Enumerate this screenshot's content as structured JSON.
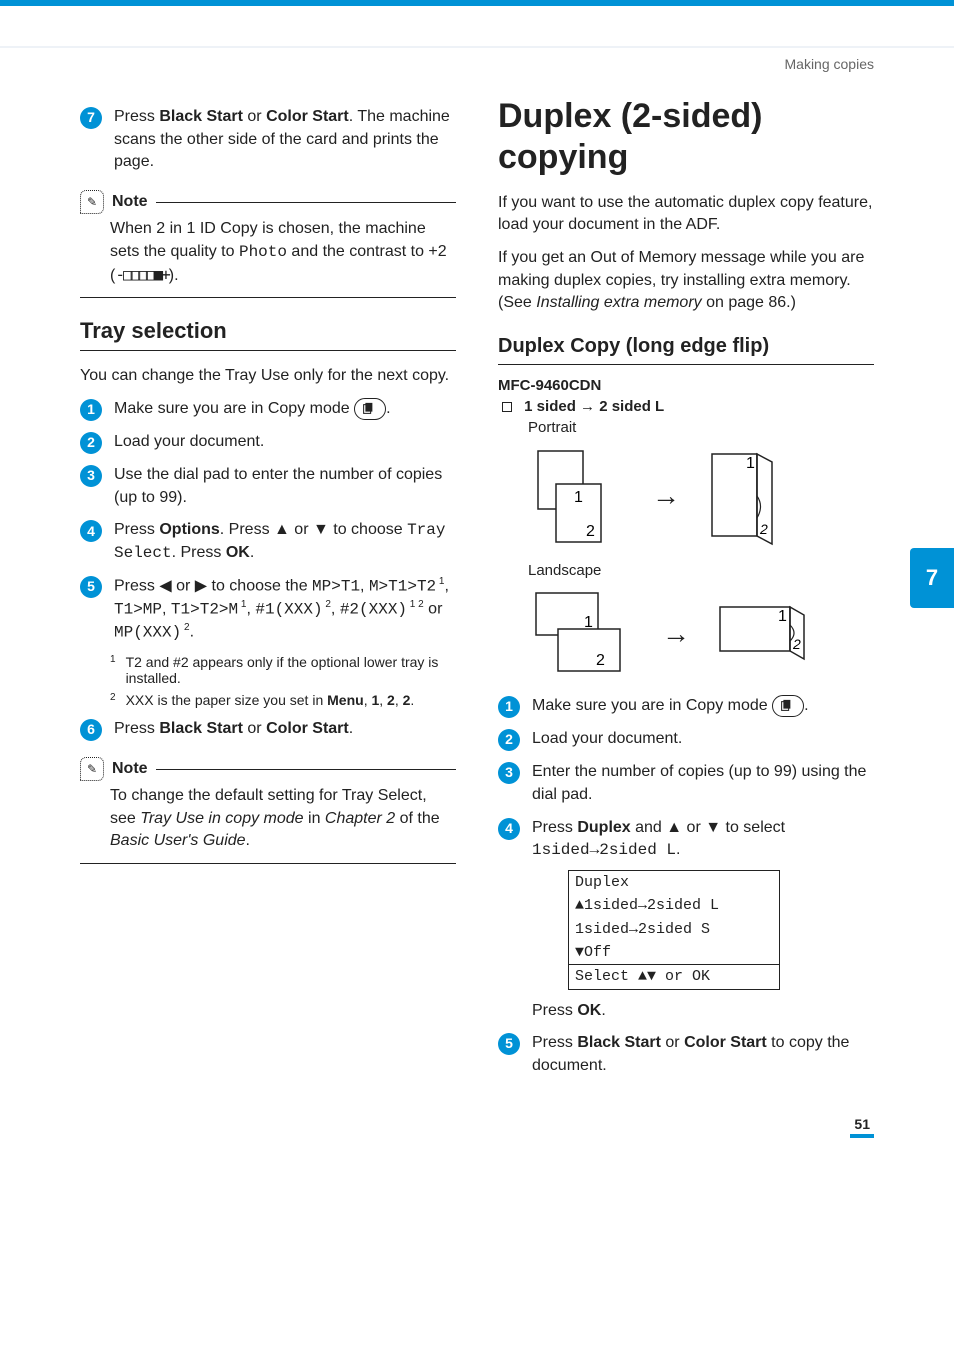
{
  "running_head": "Making copies",
  "tab_number": "7",
  "page_number": "51",
  "left": {
    "step7": {
      "n": "7",
      "pre": "Press ",
      "b1": "Black Start",
      "mid": " or ",
      "b2": "Color Start",
      "post": ". The machine scans the other side of the card and prints the page."
    },
    "note1_label": "Note",
    "note1": {
      "a": "When 2 in 1 ID Copy is chosen, the machine sets the quality to ",
      "mono": "Photo",
      "b": " and the contrast to +2 (",
      "bar": "-□□□□■+",
      "c": ")."
    },
    "h2": "Tray selection",
    "intro": "You can change the Tray Use only for the next copy.",
    "s1": {
      "n": "1",
      "t": "Make sure you are in Copy mode "
    },
    "s2": {
      "n": "2",
      "t": "Load your document."
    },
    "s3": {
      "n": "3",
      "t": "Use the dial pad to enter the number of copies (up to 99)."
    },
    "s4": {
      "n": "4",
      "a": "Press ",
      "b1": "Options",
      "b": ". Press ▲ or ▼ to choose ",
      "mono": "Tray Select",
      "c": ". Press ",
      "b2": "OK",
      "d": "."
    },
    "s5": {
      "n": "5",
      "a": "Press ◀ or ▶ to choose the ",
      "m1": "MP>T1",
      "comma1": ", ",
      "m2": "M>T1>T2",
      "sup1": " 1",
      "comma2": ", ",
      "m3": "T1>MP",
      "comma3": ", ",
      "m4": "T1>T2>M",
      "sup2": " 1",
      "comma4": ", ",
      "m5": "#1(XXX)",
      "sup3": " 2",
      "comma5": ", ",
      "m6": "#2(XXX)",
      "sup4": " 1 2",
      "or": " or ",
      "m7": "MP(XXX)",
      "sup5": " 2",
      "end": "."
    },
    "fn1": {
      "n": "1",
      "t": "T2 and #2 appears only if the optional lower tray is installed."
    },
    "fn2": {
      "n": "2",
      "a": "XXX is the paper size you set in ",
      "b1": "Menu",
      "c1": ", ",
      "b2": "1",
      "c2": ", ",
      "b3": "2",
      "c3": ", ",
      "b4": "2",
      "c4": "."
    },
    "s6": {
      "n": "6",
      "a": "Press ",
      "b1": "Black Start",
      "mid": " or ",
      "b2": "Color Start",
      "end": "."
    },
    "note2_label": "Note",
    "note2": {
      "a": "To change the default setting for Tray Select, see ",
      "i1": "Tray Use in copy mode",
      "b": " in ",
      "i2": "Chapter 2",
      "c": " of the ",
      "i3": "Basic User's Guide",
      "d": "."
    }
  },
  "right": {
    "h1": "Duplex (2-sided) copying",
    "p1": "If you want to use the automatic duplex copy feature, load your document in the ADF.",
    "p2a": "If you get an Out of Memory message while you are making duplex copies, try installing extra memory. (See ",
    "p2i": "Installing extra memory",
    "p2b": " on page 86.)",
    "h3": "Duplex Copy (long edge flip)",
    "model": "MFC-9460CDN",
    "bullet": {
      "a": "1 sided ",
      "arrow": "→",
      "b": " 2 sided L"
    },
    "orient1": "Portrait",
    "orient2": "Landscape",
    "s1": {
      "n": "1",
      "t": "Make sure you are in Copy mode "
    },
    "s2": {
      "n": "2",
      "t": "Load your document."
    },
    "s3": {
      "n": "3",
      "t": "Enter the number of copies (up to 99) using the dial pad."
    },
    "s4": {
      "n": "4",
      "a": "Press ",
      "b1": "Duplex",
      "b": " and ▲ or ▼ to select ",
      "mono": "1sided→2sided L",
      "c": "."
    },
    "lcd": {
      "l1": "Duplex",
      "l2": "▲1sided→2sided L",
      "l3": " 1sided→2sided S",
      "l4": "▼Off",
      "l5": "Select ▲▼ or OK"
    },
    "pressok": {
      "a": "Press ",
      "b": "OK",
      "c": "."
    },
    "s5": {
      "n": "5",
      "a": "Press ",
      "b1": "Black Start",
      "mid": " or ",
      "b2": "Color Start",
      "end": " to copy the document."
    }
  }
}
